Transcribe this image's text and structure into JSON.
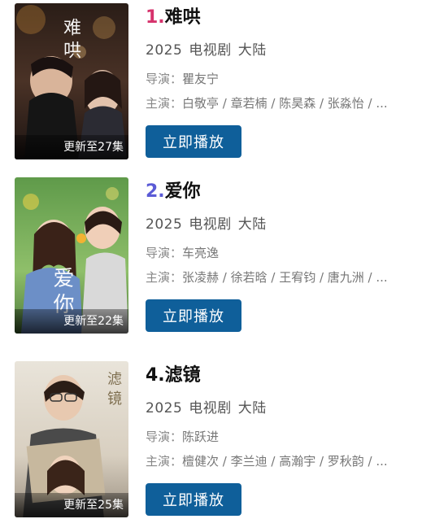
{
  "items": [
    {
      "rank": "1.",
      "rank_color": "#d6336c",
      "title": "难哄",
      "year": "2025",
      "category": "电视剧",
      "region": "大陆",
      "director_label": "导演：",
      "director": "瞿友宁",
      "cast_label": "主演：",
      "cast": "白敬亭 / 章若楠 / 陈昊森 / 张淼怡 / ...",
      "update": "更新至27集",
      "poster_art": "难哄",
      "play_label": "立即播放"
    },
    {
      "rank": "2.",
      "rank_color": "#5b5bd6",
      "title": "爱你",
      "year": "2025",
      "category": "电视剧",
      "region": "大陆",
      "director_label": "导演：",
      "director": "车亮逸",
      "cast_label": "主演：",
      "cast": "张凌赫 / 徐若晗 / 王宥钧 / 唐九洲 / ...",
      "update": "更新至22集",
      "poster_art": "爱你",
      "play_label": "立即播放"
    },
    {
      "rank": "4.",
      "rank_color": "#111111",
      "title": "滤镜",
      "year": "2025",
      "category": "电视剧",
      "region": "大陆",
      "director_label": "导演：",
      "director": "陈跃进",
      "cast_label": "主演：",
      "cast": "檀健次 / 李兰迪 / 高瀚宇 / 罗秋韵 / ...",
      "update": "更新至25集",
      "poster_art": "滤镜",
      "play_label": "立即播放"
    }
  ]
}
